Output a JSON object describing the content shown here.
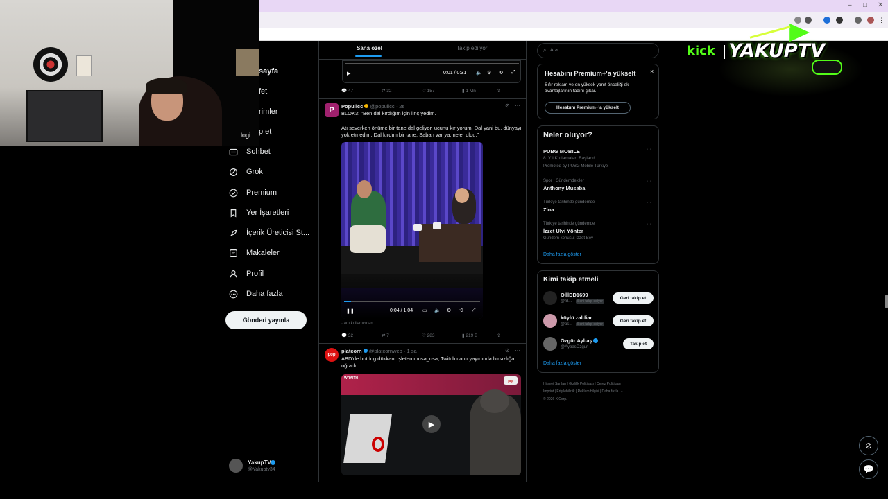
{
  "browser": {
    "window_controls": [
      "–",
      "□",
      "✕"
    ]
  },
  "sidebar": {
    "items": [
      {
        "label": "Sohbet",
        "icon": "mail-icon"
      },
      {
        "label": "Grok",
        "icon": "grok-icon"
      },
      {
        "label": "Premium",
        "icon": "premium-icon"
      },
      {
        "label": "Yer İşaretleri",
        "icon": "bookmark-icon"
      },
      {
        "label": "İçerik Üreticisi St...",
        "icon": "rocket-icon"
      },
      {
        "label": "Makaleler",
        "icon": "article-icon"
      },
      {
        "label": "Profil",
        "icon": "profile-icon"
      },
      {
        "label": "Daha fazla",
        "icon": "more-circle-icon"
      }
    ],
    "partial_items": [
      "sayfa",
      "fet",
      "rimler",
      "p et"
    ],
    "webcam_text": "logi",
    "post_button": "Gönderi yayınla",
    "account": {
      "name": "YakupTV",
      "handle": "@Yakuptv34",
      "more": "···"
    }
  },
  "feed": {
    "tabs": [
      "Sana özel",
      "Takip edilyor"
    ],
    "first_tweet": {
      "time": "0:01 / 0:31",
      "actions": [
        "47",
        "32",
        "157",
        "1 Mn"
      ]
    },
    "tweet2": {
      "name": "Populicc",
      "handle": "@populicc",
      "time": "· 2s",
      "text1": "BLOK3: \"Ben dal kırdığım için linç yedim.",
      "text2": "Atı severken önüme bir tane dal geliyor, ucunu kırıyorum. Dal yani bu, dünyayı yok etmedim. Dal kırdım bir tane. Sabah var ya, neler oldu.\"",
      "video_time": "0:04 / 1:04",
      "caption": "adı kullanıcıdan",
      "actions": [
        "32",
        "7",
        "283",
        "219 B"
      ]
    },
    "tweet3": {
      "name": "platcorn",
      "handle": "@platcornweb",
      "time": "· 1 sa",
      "text": "ABD'de hotdog dükkanı işleten musa_usa, Twitch canlı yayınında hırsızlığa uğradı.",
      "video_badge": "WRAITH"
    }
  },
  "right": {
    "search_placeholder": "Ara",
    "premium": {
      "title": "Hesabını Premium+'a yükselt",
      "body": "Sıfır reklam ve en yüksek yanıt önceliği ek avantajlarının tadını çıkar.",
      "button": "Hesabını Premium+'a yükselt",
      "close": "×"
    },
    "trends": {
      "heading": "Neler oluyor?",
      "items": [
        {
          "top": "",
          "name": "PUBG MOBILE",
          "sub": "8. Yıl Kutlamaları Başladı!",
          "extra": "Promoted by PUBG Mobile Türkiye"
        },
        {
          "top": "Spor · Gündemdekiler",
          "name": "Anthony Musaba",
          "sub": "",
          "extra": ""
        },
        {
          "top": "Türkiye tarihinde gündemde",
          "name": "Zina",
          "sub": "",
          "extra": ""
        },
        {
          "top": "Türkiye tarihinde gündemde",
          "name": "İzzet Ulvi Yönter",
          "sub": "Gündem konusu: İzzet Bey",
          "extra": ""
        }
      ],
      "more": "Daha fazla göster"
    },
    "who_to_follow": {
      "heading": "Kimi takip etmeli",
      "users": [
        {
          "name": "OlllDD1699",
          "handle": "@fd...",
          "tag": "Seni takip ediyor",
          "button": "Geri takip et"
        },
        {
          "name": "köylü zaldiar",
          "handle": "@as...",
          "tag": "Seni takip ediyor",
          "button": "Geri takip et"
        },
        {
          "name": "Özgür Aybaş",
          "handle": "@AybasOzgur",
          "tag": "",
          "button": "Takip et"
        }
      ],
      "more": "Daha fazla göster"
    },
    "footer": {
      "line1": [
        "Hizmet Şartları",
        "Gizlilik Politikası",
        "Çerez Politikası"
      ],
      "line2": [
        "Imprint",
        "Erişilebilirlik",
        "Reklam bilgisi",
        "Daha fazla ···"
      ],
      "copyright": "© 2026 X Corp."
    }
  },
  "overlay": {
    "kick": "kick",
    "brand": "YAKUPTV"
  }
}
